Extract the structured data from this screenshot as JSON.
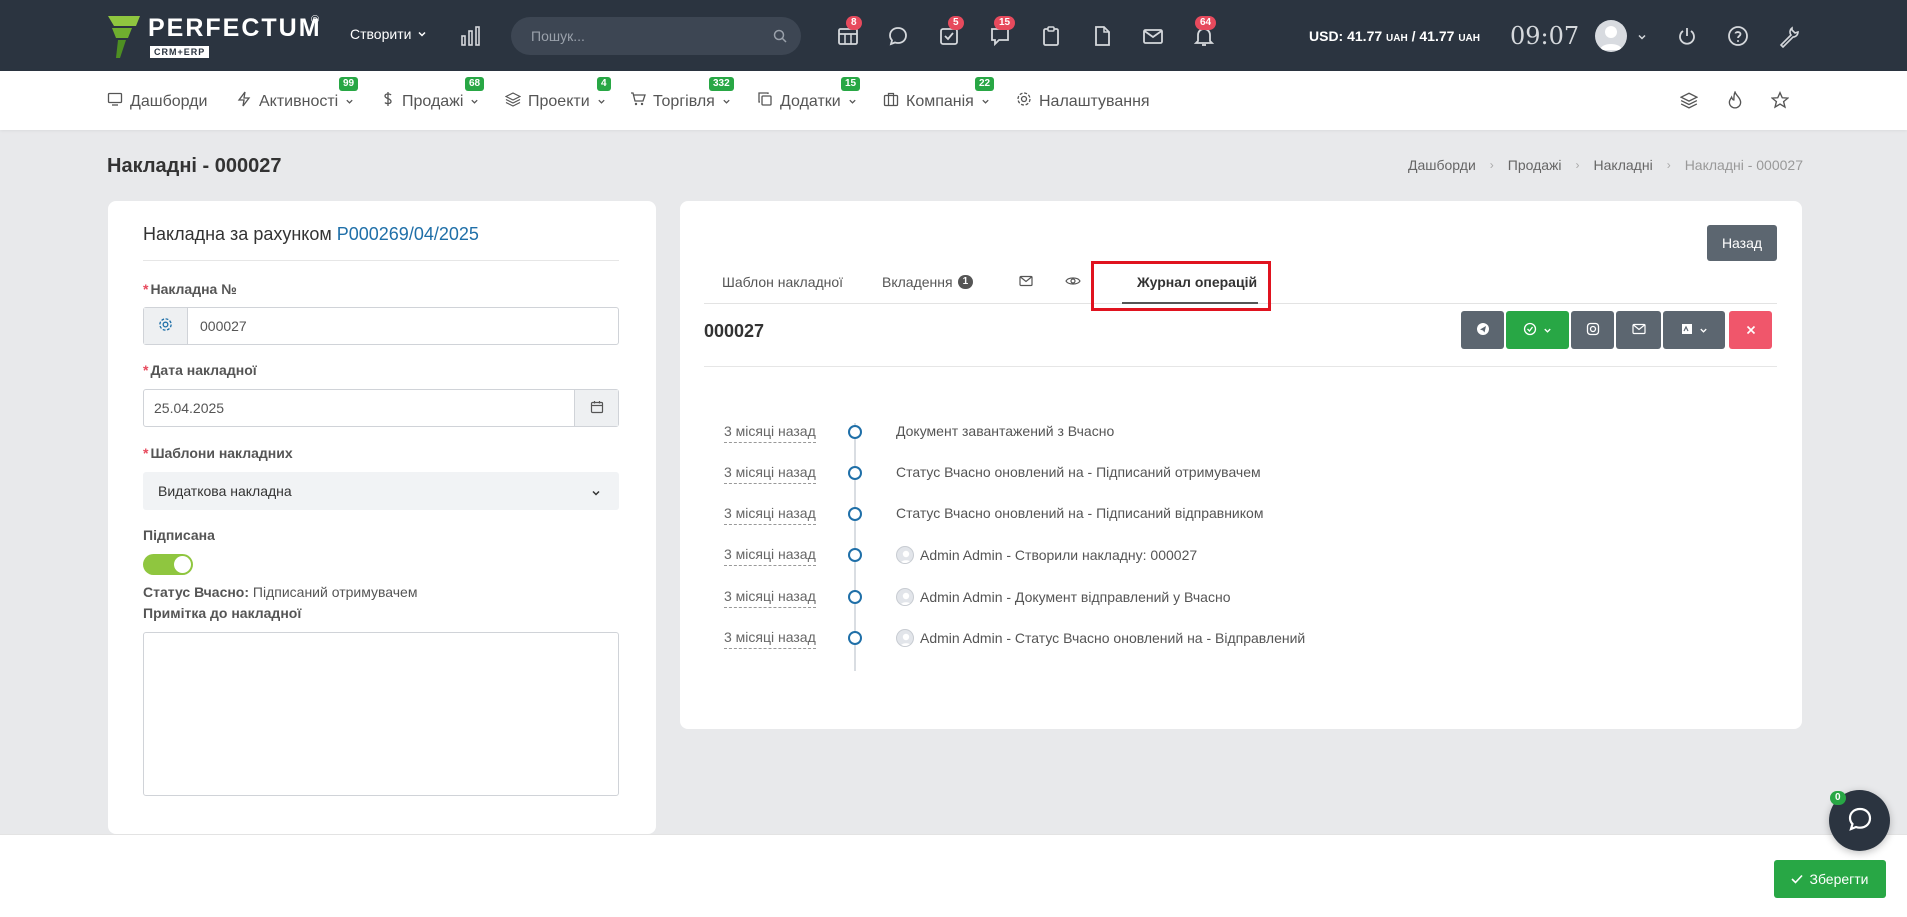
{
  "app": {
    "logo_word": "PERFECTUM",
    "logo_reg": "®",
    "logo_sub": "CRM+ERP"
  },
  "topbar": {
    "create_label": "Створити",
    "search_placeholder": "Пошук...",
    "badges": {
      "calendar": "8",
      "tasks": "5",
      "discussions": "15",
      "notifications": "64"
    },
    "rates_text": "USD: 41.77",
    "rates_unit1": "UAH",
    "rates_sep": " / 41.77 ",
    "rates_unit2": "UAH",
    "time": "09:07"
  },
  "menu": {
    "items": [
      {
        "label": "Дашборди",
        "icon": "monitor-icon"
      },
      {
        "label": "Активності",
        "icon": "bolt-icon",
        "badge": "99"
      },
      {
        "label": "Продажі",
        "icon": "dollar-icon",
        "badge": "68"
      },
      {
        "label": "Проекти",
        "icon": "layers-icon",
        "badge": "4"
      },
      {
        "label": "Торгівля",
        "icon": "cart-icon",
        "badge": "332"
      },
      {
        "label": "Додатки",
        "icon": "copy-icon",
        "badge": "15"
      },
      {
        "label": "Компанія",
        "icon": "briefcase-icon",
        "badge": "22"
      },
      {
        "label": "Налаштування",
        "icon": "gear-icon"
      }
    ]
  },
  "page": {
    "title": "Накладні - 000027",
    "breadcrumb": [
      "Дашборди",
      "Продажі",
      "Накладні",
      "Накладні - 000027"
    ]
  },
  "form": {
    "heading_prefix": "Накладна за рахунком ",
    "heading_link": "P000269/04/2025",
    "number_label": "Накладна №",
    "number_value": "000027",
    "date_label": "Дата накладної",
    "date_value": "25.04.2025",
    "template_label": "Шаблони накладних",
    "template_value": "Видаткова накладна",
    "signed_label": "Підписана",
    "signed_on": true,
    "status_label": "Статус Вчасно:",
    "status_value": " Підписаний отримувачем",
    "note_label": "Примітка до накладної",
    "note_value": ""
  },
  "panel": {
    "back_label": "Назад",
    "tabs": [
      {
        "label": "Шаблон накладної"
      },
      {
        "label": "Вкладення",
        "count": "1"
      },
      {
        "label": "",
        "icon": "envelope-icon"
      },
      {
        "label": "",
        "icon": "eye-icon"
      },
      {
        "label": "Журнал операцій",
        "active": true
      }
    ],
    "doc_number": "000027",
    "timeline": [
      {
        "time": "3 місяці назад",
        "text": "Документ завантажений з Вчасно",
        "avatar": false
      },
      {
        "time": "3 місяці назад",
        "text": "Статус Вчасно оновлений на - Підписаний отримувачем",
        "avatar": false
      },
      {
        "time": "3 місяці назад",
        "text": "Статус Вчасно оновлений на - Підписаний відправником",
        "avatar": false
      },
      {
        "time": "3 місяці назад",
        "text": "Admin Admin - Створили накладну: 000027",
        "avatar": true
      },
      {
        "time": "3 місяці назад",
        "text": "Admin Admin - Документ відправлений у Вчасно",
        "avatar": true
      },
      {
        "time": "3 місяці назад",
        "text": "Admin Admin - Статус Вчасно оновлений на - Відправлений",
        "avatar": true
      }
    ]
  },
  "footer": {
    "save_label": "Зберегти",
    "chat_badge": "0"
  },
  "colors": {
    "topbar": "#2b3440",
    "accent_green": "#28a745",
    "badge_red": "#e74a5d",
    "link_blue": "#1f6fa8",
    "highlight_red": "#e0131f"
  }
}
